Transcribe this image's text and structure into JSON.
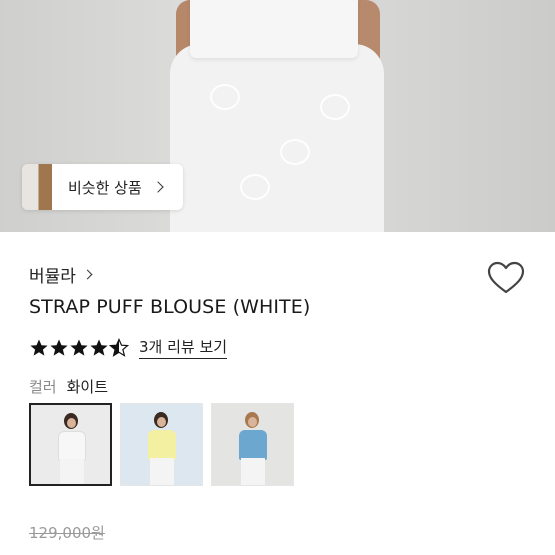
{
  "hero": {
    "similar_products_label": "비슷한 상품"
  },
  "product": {
    "brand": "버뮬라",
    "title": "STRAP PUFF BLOUSE (WHITE)",
    "rating": 4.5,
    "review_link": "3개 리뷰 보기",
    "color_label": "컬러",
    "color_value": "화이트",
    "swatches": [
      {
        "color_name": "white",
        "shirt_color": "#f7f7f7",
        "bg_color": "#ebebeb",
        "selected": true
      },
      {
        "color_name": "yellow",
        "shirt_color": "#f3f0a2",
        "bg_color": "#dde7ef",
        "selected": false
      },
      {
        "color_name": "blue",
        "shirt_color": "#6ba7cf",
        "bg_color": "#e4e4e2",
        "selected": false
      }
    ],
    "original_price": "129,000원",
    "sale_price": ""
  },
  "colors": {
    "star": "#111111",
    "text": "#1a1a1a",
    "muted": "#8a8a8a"
  }
}
